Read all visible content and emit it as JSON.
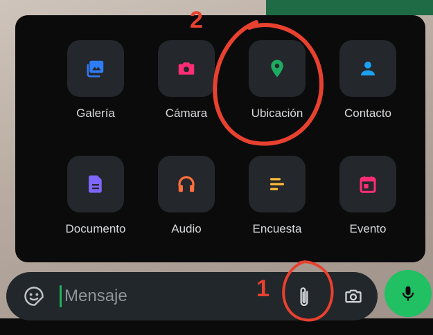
{
  "attach_menu": {
    "items": [
      {
        "label": "Galería",
        "icon": "gallery-icon",
        "color": "#2f7cf6"
      },
      {
        "label": "Cámara",
        "icon": "camera-icon",
        "color": "#ff2e74"
      },
      {
        "label": "Ubicación",
        "icon": "location-pin-icon",
        "color": "#1daa61"
      },
      {
        "label": "Contacto",
        "icon": "contact-icon",
        "color": "#1da1f2"
      },
      {
        "label": "Documento",
        "icon": "document-icon",
        "color": "#7f66ff"
      },
      {
        "label": "Audio",
        "icon": "headphones-icon",
        "color": "#ff6f3d"
      },
      {
        "label": "Encuesta",
        "icon": "poll-icon",
        "color": "#ffbc38"
      },
      {
        "label": "Evento",
        "icon": "calendar-icon",
        "color": "#ff2e74"
      }
    ]
  },
  "composer": {
    "placeholder": "Mensaje",
    "accent_color": "#21c063"
  },
  "annotations": {
    "step_1": "1",
    "step_2": "2",
    "color": "#e8412f"
  }
}
